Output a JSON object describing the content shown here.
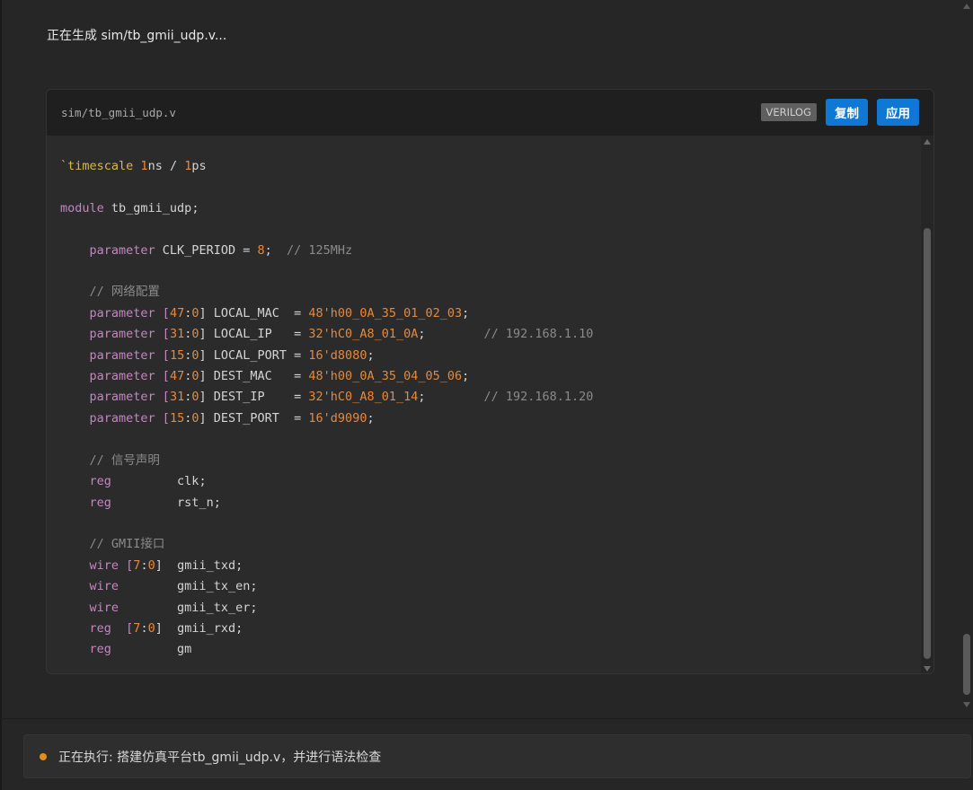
{
  "status": {
    "title": "正在生成 sim/tb_gmii_udp.v..."
  },
  "code_block": {
    "path": "sim/tb_gmii_udp.v",
    "language": "VERILOG",
    "copy_label": "复制",
    "apply_label": "应用"
  },
  "code": {
    "t_dir": "`timescale",
    "t_num1": "1",
    "t_ns": "ns / ",
    "t_num2": "1",
    "t_ps": "ps",
    "m_kw": "module",
    "m_name": " tb_gmii_udp;",
    "p_kw": "parameter",
    "p_name": " CLK_PERIOD = ",
    "p_val": "8",
    "p_semi": ";  ",
    "p_cm": "// 125MHz",
    "c_net": "// 网络配置",
    "params": [
      {
        "kw": "parameter",
        "lb": " [",
        "hi": "47",
        "colon": ":",
        "lo": "0",
        "rb": "]",
        "name": " LOCAL_MAC  = ",
        "val": "48'h00_0A_35_01_02_03",
        "tail": ";",
        "cm": ""
      },
      {
        "kw": "parameter",
        "lb": " [",
        "hi": "31",
        "colon": ":",
        "lo": "0",
        "rb": "]",
        "name": " LOCAL_IP   = ",
        "val": "32'hC0_A8_01_0A",
        "tail": ";        ",
        "cm": "// 192.168.1.10"
      },
      {
        "kw": "parameter",
        "lb": " [",
        "hi": "15",
        "colon": ":",
        "lo": "0",
        "rb": "]",
        "name": " LOCAL_PORT = ",
        "val": "16'd8080",
        "tail": ";",
        "cm": ""
      },
      {
        "kw": "parameter",
        "lb": " [",
        "hi": "47",
        "colon": ":",
        "lo": "0",
        "rb": "]",
        "name": " DEST_MAC   = ",
        "val": "48'h00_0A_35_04_05_06",
        "tail": ";",
        "cm": ""
      },
      {
        "kw": "parameter",
        "lb": " [",
        "hi": "31",
        "colon": ":",
        "lo": "0",
        "rb": "]",
        "name": " DEST_IP    = ",
        "val": "32'hC0_A8_01_14",
        "tail": ";        ",
        "cm": "// 192.168.1.20"
      },
      {
        "kw": "parameter",
        "lb": " [",
        "hi": "15",
        "colon": ":",
        "lo": "0",
        "rb": "]",
        "name": " DEST_PORT  = ",
        "val": "16'd9090",
        "tail": ";",
        "cm": ""
      }
    ],
    "c_sig": "// 信号声明",
    "sig1_kw": "reg",
    "sig1_name": "         clk;",
    "sig2_kw": "reg",
    "sig2_name": "         rst_n;",
    "c_gmii": "// GMII接口",
    "g1_kw": "wire",
    "g1_lb": " [",
    "g1_hi": "7",
    "g1_colon": ":",
    "g1_lo": "0",
    "g1_rb": "]",
    "g1_name": "  gmii_txd;",
    "g2_kw": "wire",
    "g2_name": "        gmii_tx_en;",
    "g3_kw": "wire",
    "g3_name": "        gmii_tx_er;",
    "g4_kw": "reg",
    "g4_lb": "  [",
    "g4_hi": "7",
    "g4_colon": ":",
    "g4_lo": "0",
    "g4_rb": "]",
    "g4_name": "  gmii_rxd;",
    "g5_kw": "reg",
    "g5_name": "         gm"
  },
  "execution": {
    "text": "正在执行: 搭建仿真平台tb_gmii_udp.v，并进行语法检查"
  }
}
